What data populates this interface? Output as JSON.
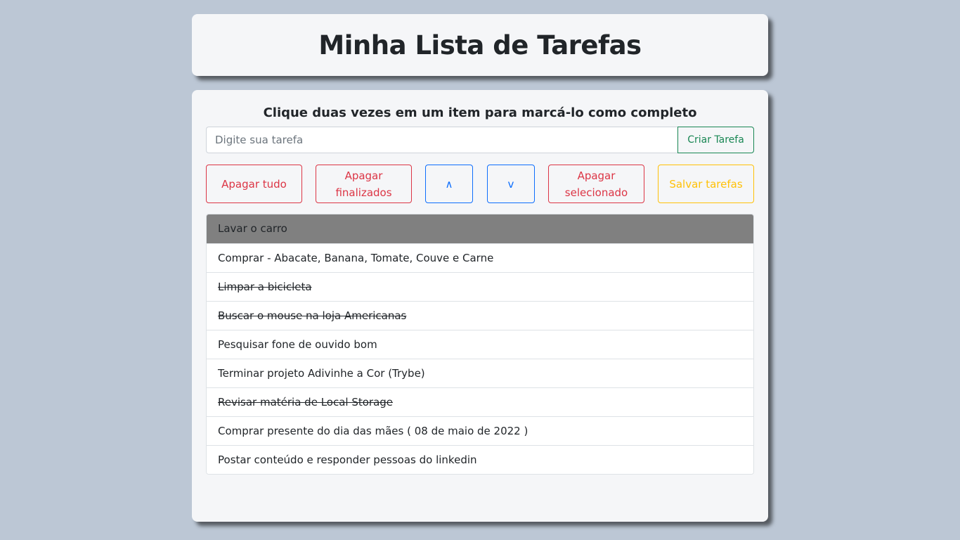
{
  "header": {
    "title": "Minha Lista de Tarefas"
  },
  "main": {
    "instructions": "Clique duas vezes em um item para marcá-lo como completo",
    "input": {
      "placeholder": "Digite sua tarefa",
      "value": ""
    },
    "create_button_label": "Criar Tarefa",
    "buttons": {
      "clear_all": "Apagar tudo",
      "clear_completed": "Apagar finalizados",
      "move_up": "∧",
      "move_down": "v",
      "remove_selected": "Apagar selecionado",
      "save_tasks": "Salvar tarefas"
    },
    "tasks": [
      {
        "text": "Lavar o carro",
        "completed": false,
        "selected": true
      },
      {
        "text": "Comprar - Abacate, Banana, Tomate, Couve e Carne",
        "completed": false,
        "selected": false
      },
      {
        "text": "Limpar a bicicleta",
        "completed": true,
        "selected": false
      },
      {
        "text": "Buscar o mouse na loja Americanas",
        "completed": true,
        "selected": false
      },
      {
        "text": "Pesquisar fone de ouvido bom",
        "completed": false,
        "selected": false
      },
      {
        "text": "Terminar projeto Adivinhe a Cor (Trybe)",
        "completed": false,
        "selected": false
      },
      {
        "text": "Revisar matéria de Local Storage",
        "completed": true,
        "selected": false
      },
      {
        "text": "Comprar presente do dia das mães ( 08 de maio de 2022 )",
        "completed": false,
        "selected": false
      },
      {
        "text": "Postar conteúdo e responder pessoas do linkedin",
        "completed": false,
        "selected": false
      }
    ]
  },
  "colors": {
    "background": "#bcc7d5",
    "card": "#f5f6f8",
    "success": "#198754",
    "danger": "#dc3545",
    "primary": "#0d6efd",
    "warning": "#ffc107",
    "selected_item": "#808080"
  }
}
